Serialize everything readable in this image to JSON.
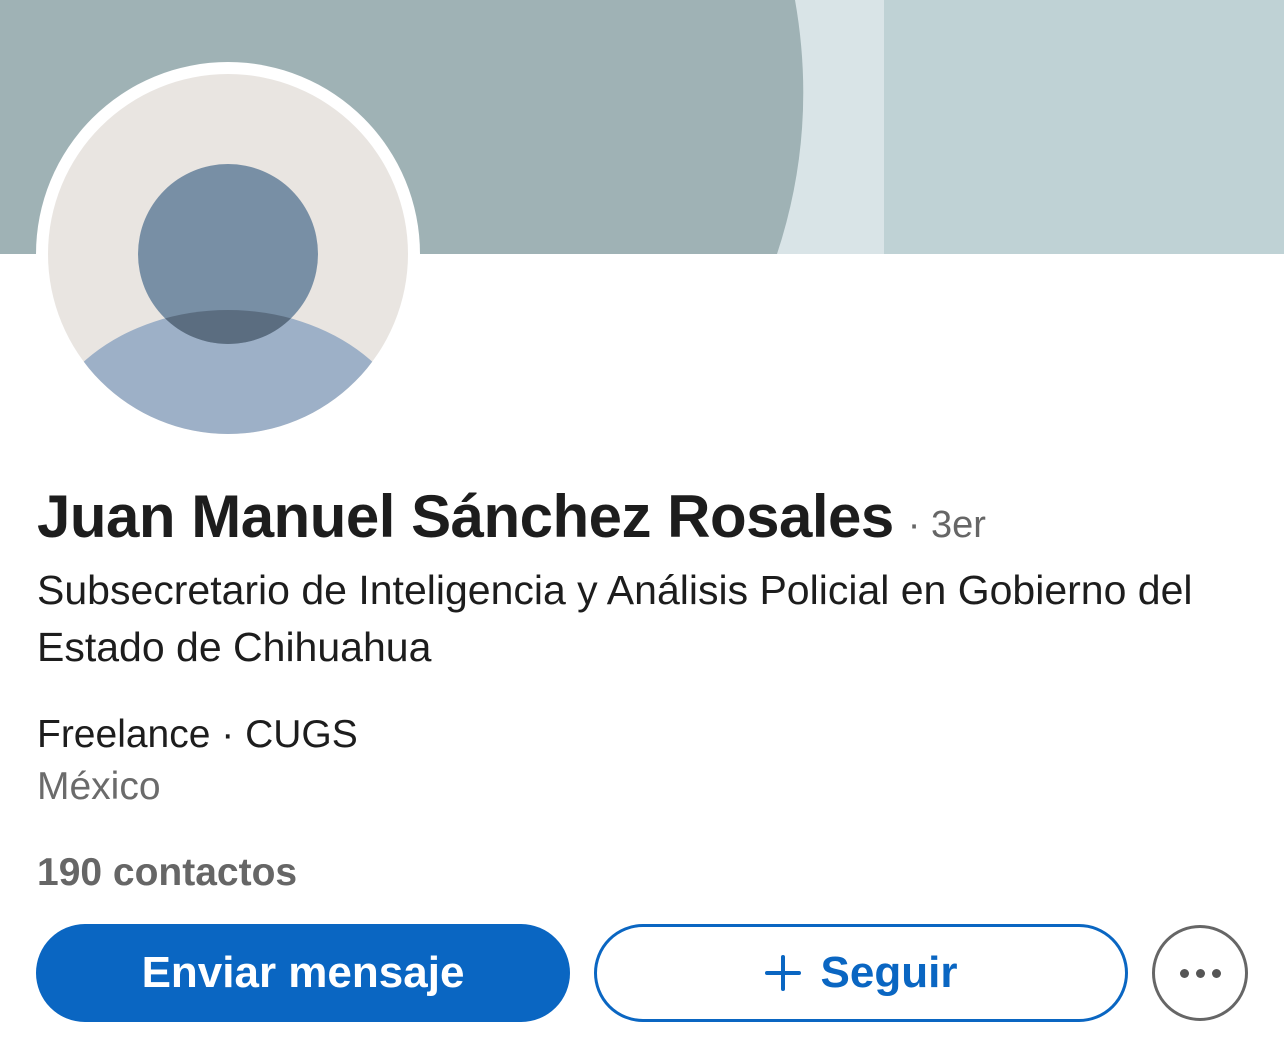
{
  "profile": {
    "name": "Juan Manuel Sánchez Rosales",
    "degree": "· 3er",
    "headline": "Subsecretario de Inteligencia y Análisis Policial en Gobierno del Estado de Chihuahua",
    "company_line": "Freelance · CUGS",
    "location": "México",
    "connections": "190 contactos"
  },
  "actions": {
    "message_label": "Enviar mensaje",
    "follow_label": "Seguir",
    "more_icon": "more-horizontal-icon",
    "follow_icon": "plus-icon"
  },
  "colors": {
    "primary": "#0a66c2",
    "banner_dark": "#9fb2b5",
    "banner_light": "#bfd2d5",
    "banner_stripe": "#d9e4e7",
    "avatar_bg": "#e9e5e1",
    "avatar_head": "#788fa5",
    "avatar_body": "#9db0c7"
  }
}
